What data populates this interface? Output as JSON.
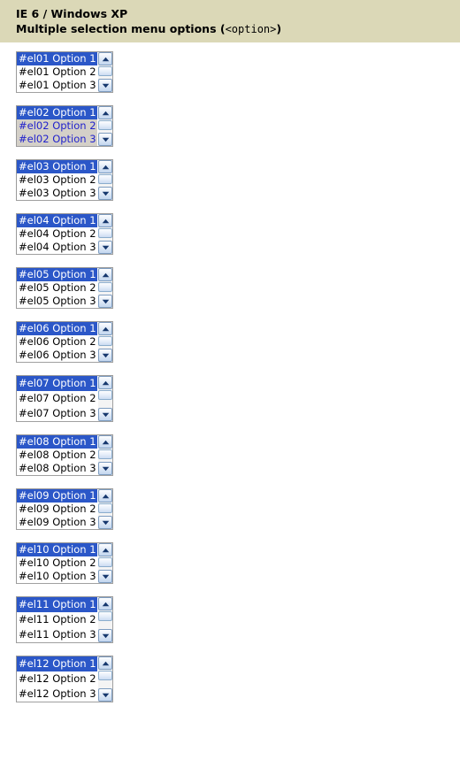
{
  "header": {
    "line1": "IE 6 / Windows XP",
    "line2_prefix": "Multiple selection menu options (",
    "line2_code": "<option>",
    "line2_suffix": ")"
  },
  "colors": {
    "header_band": "#dbd8b7",
    "page_background": "#ffffff",
    "selection_background": "#2b57c8",
    "selection_text": "#ffffff",
    "option_text": "#000000",
    "variant_option_text": "#2222cc",
    "variant_option_background": "#d4d0c8",
    "select_border": "#a0a0a0",
    "scrollbar_border": "#7d9cc0"
  },
  "scrollbar": {
    "up_arrow_icon": "chevron-up-icon",
    "down_arrow_icon": "chevron-down-icon",
    "thumb_name": "scrollbar-thumb"
  },
  "selects": [
    {
      "id": "el01",
      "variant": "default",
      "options": [
        {
          "label": "#el01 Option 1",
          "selected": true
        },
        {
          "label": "#el01 Option 2",
          "selected": false
        },
        {
          "label": "#el01 Option 3",
          "selected": false
        }
      ]
    },
    {
      "id": "el02",
      "variant": "bluetext",
      "options": [
        {
          "label": "#el02 Option 1",
          "selected": true
        },
        {
          "label": "#el02 Option 2",
          "selected": false
        },
        {
          "label": "#el02 Option 3",
          "selected": false
        }
      ]
    },
    {
      "id": "el03",
      "variant": "default",
      "options": [
        {
          "label": "#el03 Option 1",
          "selected": true
        },
        {
          "label": "#el03 Option 2",
          "selected": false
        },
        {
          "label": "#el03 Option 3",
          "selected": false
        }
      ]
    },
    {
      "id": "el04",
      "variant": "default",
      "options": [
        {
          "label": "#el04 Option 1",
          "selected": true
        },
        {
          "label": "#el04 Option 2",
          "selected": false
        },
        {
          "label": "#el04 Option 3",
          "selected": false
        }
      ]
    },
    {
      "id": "el05",
      "variant": "default",
      "options": [
        {
          "label": "#el05 Option 1",
          "selected": true
        },
        {
          "label": "#el05 Option 2",
          "selected": false
        },
        {
          "label": "#el05 Option 3",
          "selected": false
        }
      ]
    },
    {
      "id": "el06",
      "variant": "default",
      "options": [
        {
          "label": "#el06 Option 1",
          "selected": true
        },
        {
          "label": "#el06 Option 2",
          "selected": false
        },
        {
          "label": "#el06 Option 3",
          "selected": false
        }
      ]
    },
    {
      "id": "el07",
      "variant": "tall",
      "options": [
        {
          "label": "#el07 Option 1",
          "selected": true
        },
        {
          "label": "#el07 Option 2",
          "selected": false
        },
        {
          "label": "#el07 Option 3",
          "selected": false
        }
      ]
    },
    {
      "id": "el08",
      "variant": "default",
      "options": [
        {
          "label": "#el08 Option 1",
          "selected": true
        },
        {
          "label": "#el08 Option 2",
          "selected": false
        },
        {
          "label": "#el08 Option 3",
          "selected": false
        }
      ]
    },
    {
      "id": "el09",
      "variant": "default",
      "options": [
        {
          "label": "#el09 Option 1",
          "selected": true
        },
        {
          "label": "#el09 Option 2",
          "selected": false
        },
        {
          "label": "#el09 Option 3",
          "selected": false
        }
      ]
    },
    {
      "id": "el10",
      "variant": "default",
      "options": [
        {
          "label": "#el10 Option 1",
          "selected": true
        },
        {
          "label": "#el10 Option 2",
          "selected": false
        },
        {
          "label": "#el10 Option 3",
          "selected": false
        }
      ]
    },
    {
      "id": "el11",
      "variant": "tall",
      "options": [
        {
          "label": "#el11 Option 1",
          "selected": true
        },
        {
          "label": "#el11 Option 2",
          "selected": false
        },
        {
          "label": "#el11 Option 3",
          "selected": false
        }
      ]
    },
    {
      "id": "el12",
      "variant": "tall",
      "options": [
        {
          "label": "#el12 Option 1",
          "selected": true
        },
        {
          "label": "#el12 Option 2",
          "selected": false
        },
        {
          "label": "#el12 Option 3",
          "selected": false
        }
      ]
    }
  ]
}
